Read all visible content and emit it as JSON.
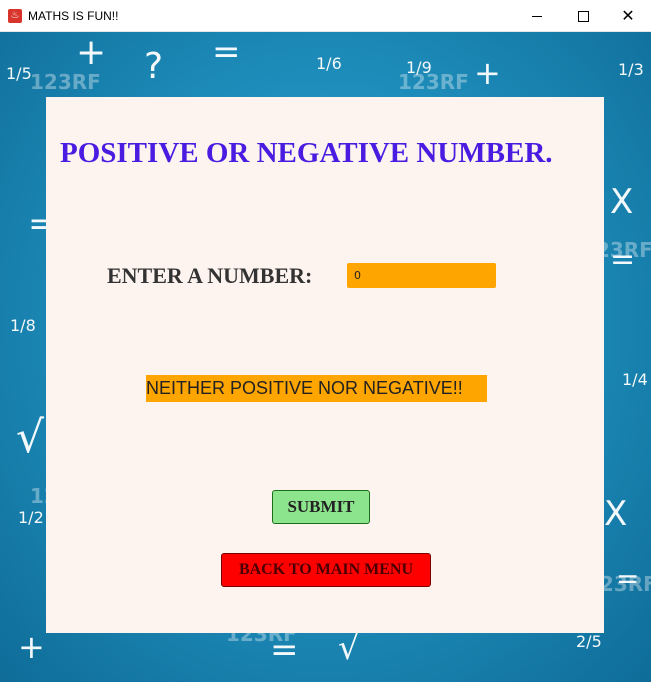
{
  "window": {
    "title": "MATHS IS FUN!!",
    "app_icon_glyph": "♨",
    "controls": {
      "minimize_icon": "minimize-icon",
      "maximize_icon": "maximize-icon",
      "close_icon": "close-icon",
      "close_glyph": "✕"
    }
  },
  "background": {
    "doodles": [
      "+",
      "?",
      "=",
      "+",
      "=",
      "X",
      "=",
      "√",
      "X",
      "=",
      "√",
      "+",
      "="
    ],
    "fractions": [
      "1/5",
      "1/6",
      "1/9",
      "1/3",
      "1/8",
      "1/4",
      "1/2",
      "2/5"
    ],
    "watermark": "123RF"
  },
  "panel": {
    "heading": "POSITIVE OR NEGATIVE NUMBER.",
    "enter_label": "ENTER A NUMBER:",
    "number_input": {
      "value": "0",
      "placeholder": ""
    },
    "result_text": "NEITHER POSITIVE NOR NEGATIVE!!",
    "submit_label": "SUBMIT",
    "back_label": "BACK TO MAIN MENU"
  },
  "colors": {
    "heading": "#4a1be0",
    "input_bg": "#ffa500",
    "result_bg": "#ffa500",
    "submit_bg": "#8ce58c",
    "back_bg": "#ff0000",
    "panel_bg": "#fdf4ef",
    "background": "#1f8fbd"
  }
}
